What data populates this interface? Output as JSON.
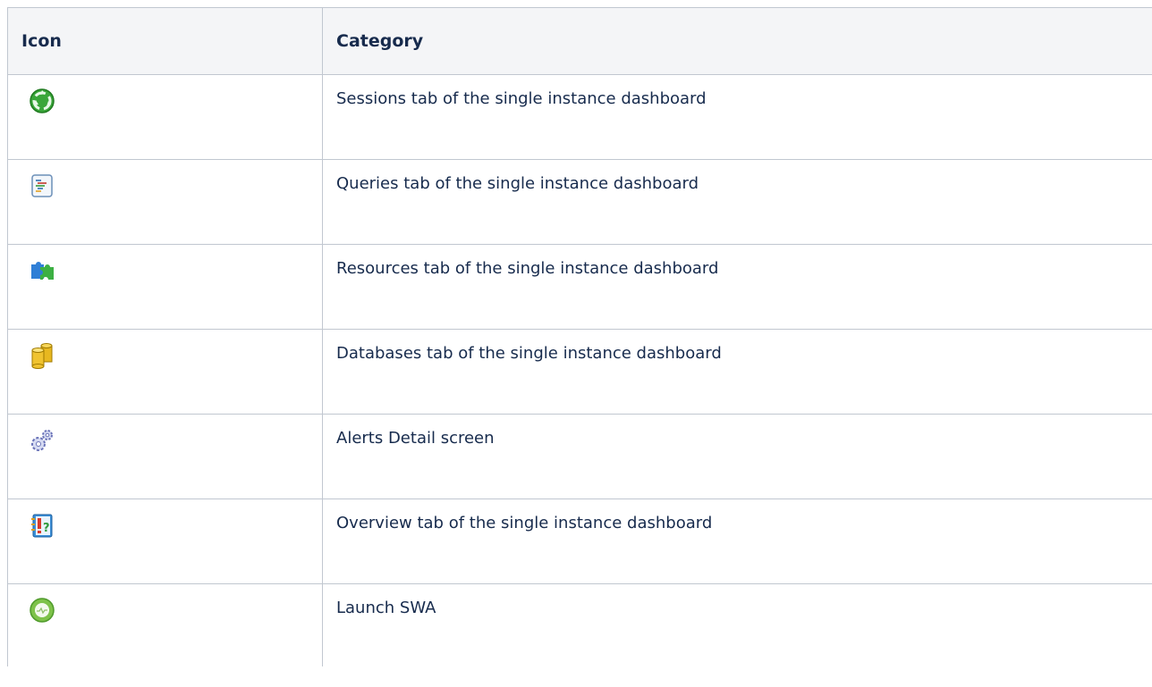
{
  "table": {
    "headers": {
      "icon": "Icon",
      "category": "Category"
    },
    "rows": [
      {
        "icon": "sessions-recycle-icon",
        "category": "Sessions tab of the single instance dashboard"
      },
      {
        "icon": "queries-document-icon",
        "category": "Queries tab of the single instance dashboard"
      },
      {
        "icon": "resources-puzzle-icon",
        "category": "Resources tab of the single instance dashboard"
      },
      {
        "icon": "databases-cylinder-icon",
        "category": "Databases tab of the single instance dashboard"
      },
      {
        "icon": "alerts-gears-icon",
        "category": "Alerts Detail screen"
      },
      {
        "icon": "overview-notebook-icon",
        "category": "Overview tab of the single instance dashboard"
      },
      {
        "icon": "launch-swa-circle-icon",
        "category": "Launch SWA"
      }
    ]
  }
}
